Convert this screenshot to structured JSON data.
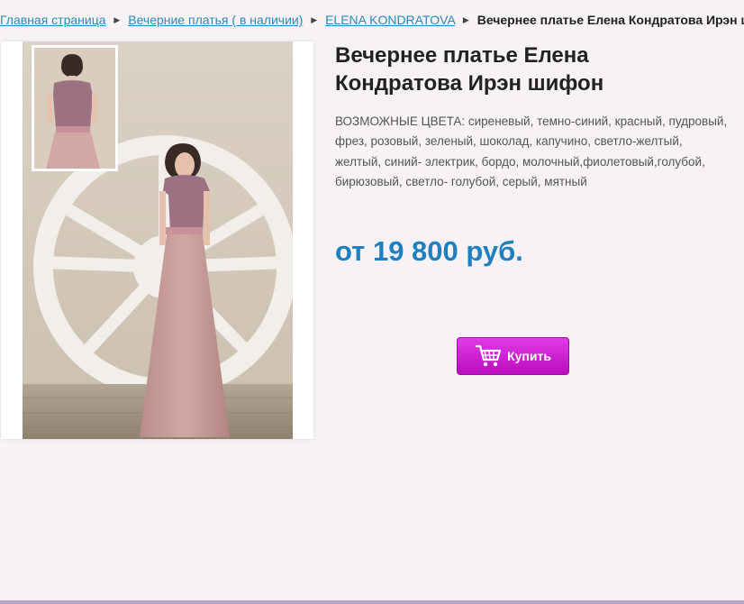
{
  "breadcrumb": {
    "items": [
      {
        "label": "Главная страница"
      },
      {
        "label": "Вечерние платья ( в наличии)"
      },
      {
        "label": "ELENA KONDRATOVA"
      }
    ],
    "current": "Вечернее платье Елена Кондратова Ирэн шифон"
  },
  "product": {
    "title": "Вечернее платье Елена Кондратова Ирэн шифон",
    "colors_label": "ВОЗМОЖНЫЕ ЦВЕТА: сиреневый, темно-синий, красный, пудровый, фрез, розовый, зеленый, шоколад, капучино, светло-желтый, желтый, синий- электрик, бордо, молочный,фиолетовый,голубой, бирюзовый, светло- голубой, серый, мятный",
    "price": "от 19 800 руб.",
    "buy_label": "Купить"
  },
  "icons": {
    "separator": "triangle-right-icon",
    "cart": "shopping-cart-icon"
  },
  "colors": {
    "link": "#2a8ab8",
    "price": "#1f7fbf",
    "button": "#c51fc9",
    "background": "#f6f2f6",
    "footer_bar": "#b6a6c6"
  }
}
